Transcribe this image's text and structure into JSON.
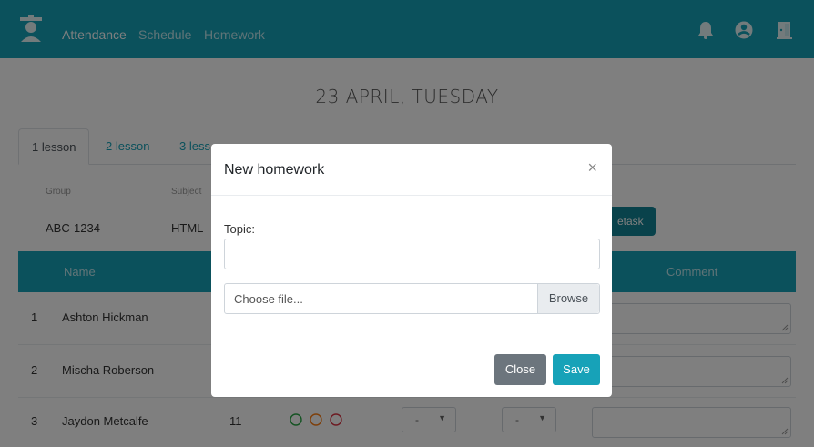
{
  "nav": {
    "items": [
      {
        "label": "Attendance",
        "active": true
      },
      {
        "label": "Schedule",
        "active": false
      },
      {
        "label": "Homework",
        "active": false
      }
    ],
    "icons": [
      "bell-icon",
      "user-circle-icon",
      "exit-door-icon"
    ],
    "colors": {
      "primary": "#17a2b8",
      "dark": "#138496"
    }
  },
  "main": {
    "date": "23 APRIL, TUESDAY",
    "tabs": [
      {
        "label": "1 lesson"
      },
      {
        "label": "2 lesson"
      },
      {
        "label": "3 less"
      }
    ],
    "group": {
      "label": "Group",
      "value": "ABC-1234"
    },
    "subject": {
      "label": "Subject",
      "value": "HTML"
    },
    "retask_label": "etask",
    "table": {
      "headers": {
        "name": "Name",
        "comment": "Comment"
      },
      "rows": [
        {
          "num": "1",
          "name": "Ashton Hickman"
        },
        {
          "num": "2",
          "name": "Mischa Roberson"
        },
        {
          "num": "3",
          "name": "Jaydon Metcalfe",
          "score": "11",
          "sel1": "-",
          "sel2": "-"
        }
      ]
    }
  },
  "modal": {
    "title": "New homework",
    "close_symbol": "×",
    "topic_label": "Topic:",
    "topic_value": "",
    "file_placeholder": "Choose file...",
    "browse_label": "Browse",
    "close_label": "Close",
    "save_label": "Save"
  }
}
